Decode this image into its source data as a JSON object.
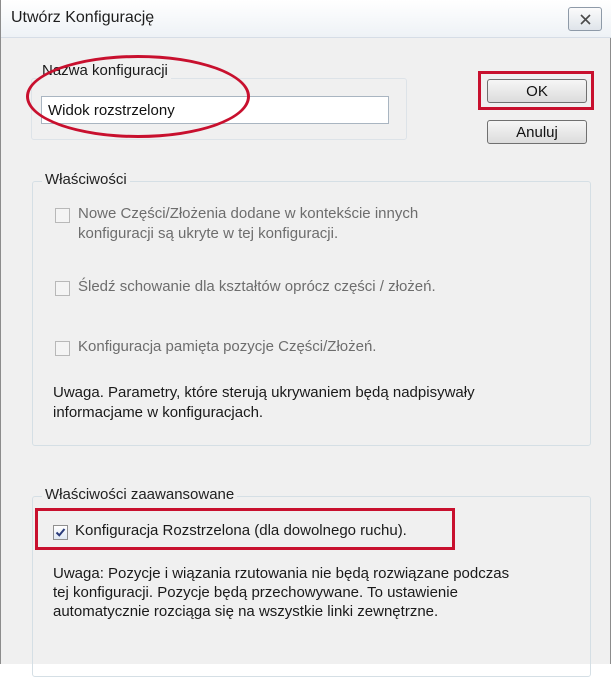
{
  "window": {
    "title": "Utwórz Konfigurację"
  },
  "config_name": {
    "label": "Nazwa konfiguracji",
    "value": "Widok rozstrzelony"
  },
  "buttons": {
    "ok": "OK",
    "cancel": "Anuluj"
  },
  "properties": {
    "legend": "Właściwości",
    "options": [
      {
        "line1": "Nowe Części/Złożenia dodane w kontekście innych",
        "line2": "konfiguracji są ukryte w tej konfiguracji.",
        "checked": false,
        "enabled": false
      },
      {
        "line1": "Śledź schowanie dla kształtów oprócz części / złożeń.",
        "checked": false,
        "enabled": false
      },
      {
        "line1": "Konfiguracja pamięta pozycje Części/Złożeń.",
        "checked": false,
        "enabled": false
      }
    ],
    "note_line1": "Uwaga. Parametry, które sterują ukrywaniem będą nadpisywały",
    "note_line2": "informacjame w konfiguracjach."
  },
  "advanced": {
    "legend": "Właściwości zaawansowane",
    "option_label": "Konfiguracja Rozstrzelona (dla dowolnego ruchu).",
    "option_checked": true,
    "note_line1": "Uwaga: Pozycje i wiązania rzutowania nie będą rozwiązane podczas",
    "note_line2": "tej konfiguracji. Pozycje będą przechowywane.  To ustawienie",
    "note_line3": "automatycznie rozciąga się na wszystkie linki zewnętrzne."
  },
  "annotation_color": "#c8102e",
  "icons": {
    "close": "close-icon",
    "check": "checkmark-icon"
  }
}
